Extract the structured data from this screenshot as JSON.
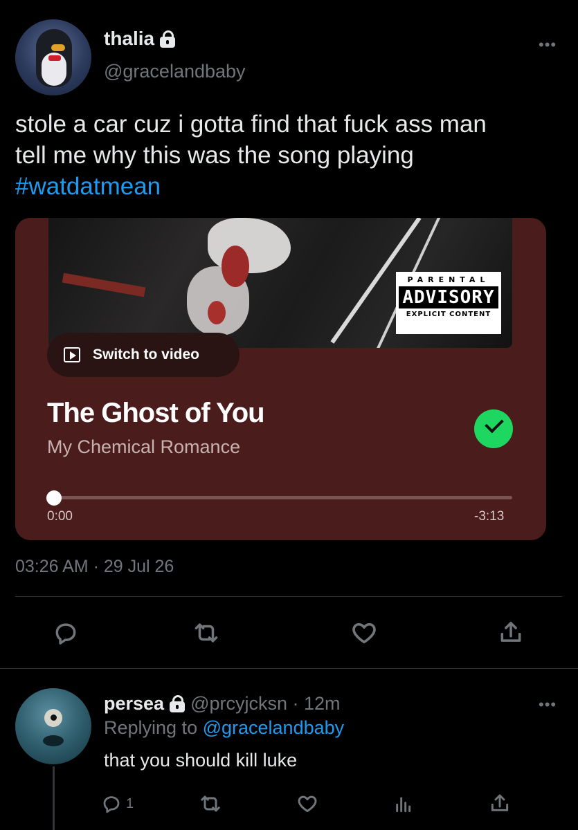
{
  "tweet": {
    "display_name": "thalia",
    "handle": "@gracelandbaby",
    "text_line1": "stole a car cuz i gotta find that fuck ass man",
    "text_line2": "tell me why this was the song playing",
    "hashtag": "#watdatmean",
    "timestamp": "03:26 AM · 29 Jul 26",
    "more_icon": "•••"
  },
  "spotify_card": {
    "switch_label": "Switch to video",
    "song_title": "The Ghost of You",
    "artist": "My Chemical Romance",
    "time_start": "0:00",
    "time_end": "-3:13",
    "progress_fraction": 0.0,
    "advisory_line1": "PARENTAL",
    "advisory_line2": "ADVISORY",
    "advisory_line3": "EXPLICIT CONTENT",
    "card_color": "#4a1c1b",
    "saved_check_color": "#1ed760"
  },
  "actions": {
    "icons": [
      "reply-icon",
      "retweet-icon",
      "like-icon",
      "share-icon"
    ]
  },
  "reply": {
    "display_name": "persea",
    "meta": "@prcyjcksn · 12m",
    "replying_prefix": "Replying to ",
    "replying_to": "@gracelandbaby",
    "text": "that you should kill luke",
    "reply_count": "1",
    "more_icon": "•••",
    "icons": [
      "reply-icon",
      "retweet-icon",
      "like-icon",
      "analytics-icon",
      "share-icon"
    ]
  },
  "colors": {
    "background": "#000000",
    "text": "#e7e9ea",
    "muted": "#71767b",
    "link": "#1d9bf0"
  }
}
